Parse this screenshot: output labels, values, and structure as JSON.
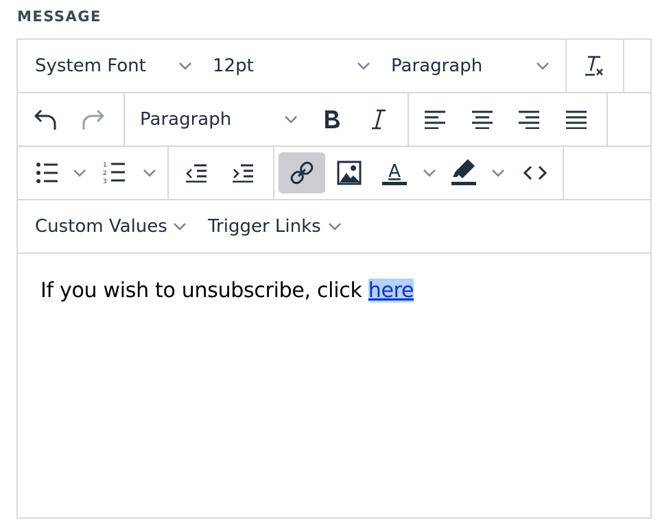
{
  "field_label": "MESSAGE",
  "toolbar": {
    "font_family": "System Font",
    "font_size": "12pt",
    "block_format_top": "Paragraph",
    "block_format_second": "Paragraph",
    "custom_values_label": "Custom Values",
    "trigger_links_label": "Trigger Links"
  },
  "content": {
    "text": "If you wish to unsubscribe, click ",
    "link_text": "here"
  },
  "colors": {
    "border": "#d9d9d9",
    "icon": "#222f3e",
    "active_button_bg": "#cccdd1",
    "link": "#0c32ce",
    "link_selection": "#b4d2f7"
  }
}
